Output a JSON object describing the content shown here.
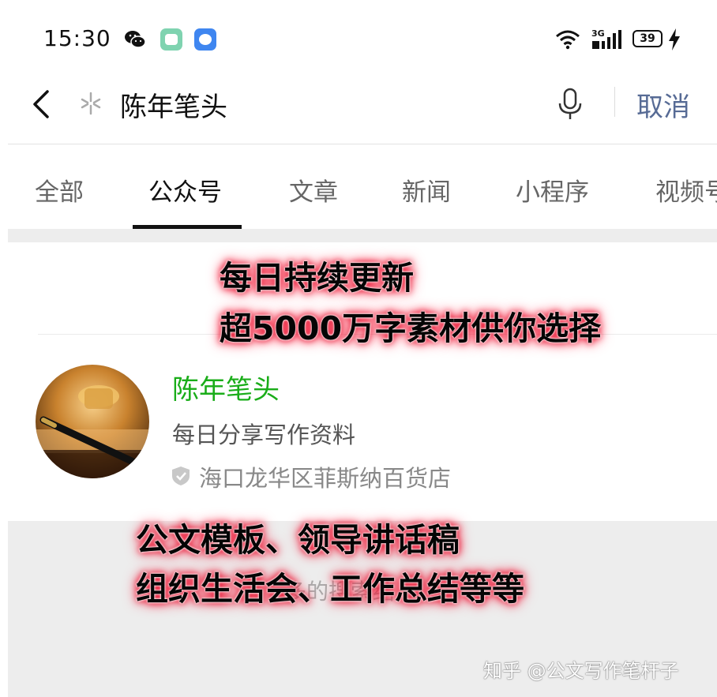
{
  "status_bar": {
    "time": "15:30",
    "network": "3G",
    "battery": "39",
    "icons": [
      "wechat-icon",
      "app-green-icon",
      "app-blue-icon",
      "wifi-icon",
      "signal-icon",
      "battery-icon",
      "charging-icon"
    ]
  },
  "search": {
    "query": "陈年笔头",
    "cancel_label": "取消"
  },
  "tabs": [
    {
      "label": "全部"
    },
    {
      "label": "公众号"
    },
    {
      "label": "文章"
    },
    {
      "label": "新闻"
    },
    {
      "label": "小程序"
    },
    {
      "label": "视频号"
    }
  ],
  "active_tab": "公众号",
  "result": {
    "name": "陈年笔头",
    "description": "每日分享写作资料",
    "location": "海口龙华区菲斯纳百货店"
  },
  "more_text": "多的搜索结",
  "overlay": {
    "line1": "每日持续更新",
    "line2": "超5000万字素材供你选择",
    "line3": "公文模板、领导讲话稿",
    "line4": "组织生活会、工作总结等等"
  },
  "watermark": "知乎 @公文写作笔杆子",
  "colors": {
    "accent_green": "#1aad19",
    "link_blue": "#576b95",
    "overlay_glow": "#e8102e"
  }
}
